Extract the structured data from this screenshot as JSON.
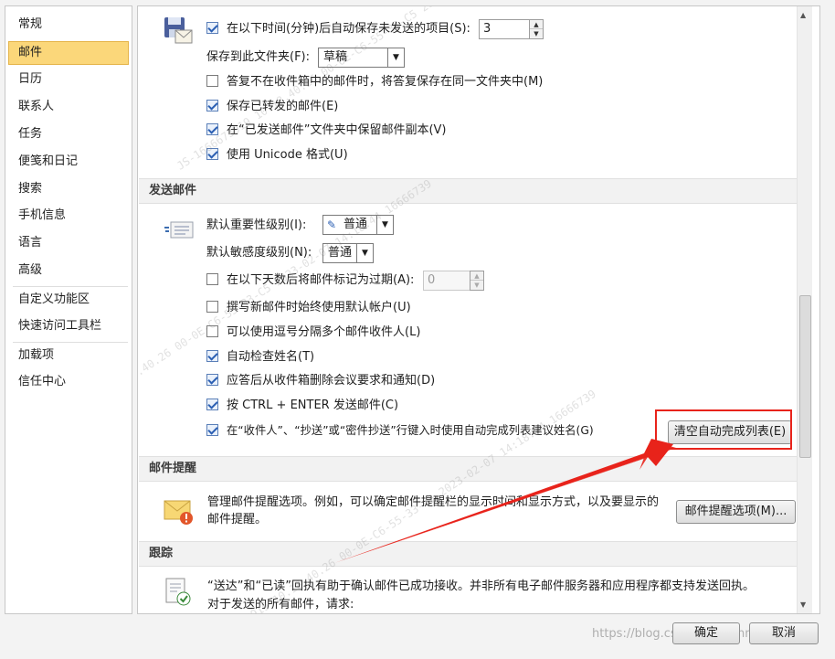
{
  "sidebar": {
    "items": [
      "常规",
      "邮件",
      "日历",
      "联系人",
      "任务",
      "便笺和日记",
      "搜索",
      "手机信息",
      "语言",
      "高级",
      "自定义功能区",
      "快速访问工具栏",
      "加载项",
      "信任中心"
    ],
    "active_index": 1
  },
  "save": {
    "autosave_label": "在以下时间(分钟)后自动保存未发送的项目(S):",
    "autosave_value": "3",
    "save_to_label": "保存到此文件夹(F):",
    "save_to_value": "草稿",
    "opt_reply_same_folder": "答复不在收件箱中的邮件时，将答复保存在同一文件夹中(M)",
    "opt_save_forwarded": "保存已转发的邮件(E)",
    "opt_keep_sent_copy": "在“已发送邮件”文件夹中保留邮件副本(V)",
    "opt_unicode": "使用 Unicode 格式(U)"
  },
  "send": {
    "header": "发送邮件",
    "importance_label": "默认重要性级别(I):",
    "importance_value": "普通",
    "sensitivity_label": "默认敏感度级别(N):",
    "sensitivity_value": "普通",
    "opt_expire": "在以下天数后将邮件标记为过期(A):",
    "expire_value": "0",
    "opt_default_account": "撰写新邮件时始终使用默认帐户(U)",
    "opt_comma_separate": "可以使用逗号分隔多个邮件收件人(L)",
    "opt_check_names": "自动检查姓名(T)",
    "opt_delete_meeting": "应答后从收件箱删除会议要求和通知(D)",
    "opt_ctrl_enter": "按 CTRL + ENTER 发送邮件(C)",
    "opt_autocomplete": "在“收件人”、“抄送”或“密件抄送”行键入时使用自动完成列表建议姓名(G)",
    "clear_autocomplete_button": "清空自动完成列表(E)"
  },
  "alerts": {
    "header": "邮件提醒",
    "description_line1": "管理邮件提醒选项。例如，可以确定邮件提醒栏的显示时间和显示方式，以及要显示的",
    "description_line2": "邮件提醒。",
    "options_button": "邮件提醒选项(M)..."
  },
  "tracking": {
    "header": "跟踪",
    "description_line1": "“送达”和“已读”回执有助于确认邮件已成功接收。并非所有电子邮件服务器和应用程序都支持发送回执。",
    "description_line2": "对于发送的所有邮件，请求:"
  },
  "footer": {
    "ok_button": "确定",
    "cancel_button": "取消",
    "watermark_url": "https://blog.csdn.net/Wanmi"
  },
  "watermark_text": "JS-1666673919 10.18.40.26 00-0E-C6-55-33-C5 2023-02-07 14:18:44 16666739",
  "colors": {
    "highlight_red": "#e8231b",
    "arrow_red": "#e8231b",
    "active_nav": "#fbd77a"
  }
}
